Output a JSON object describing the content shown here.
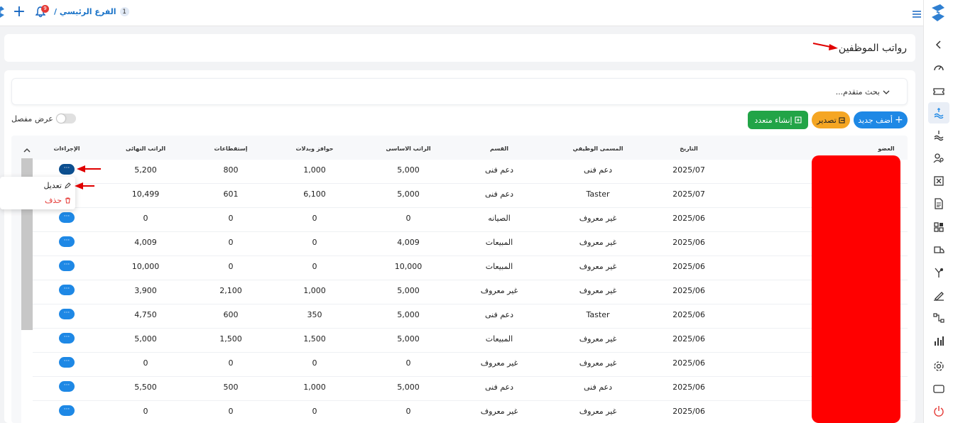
{
  "topbar": {
    "branch_number": "1",
    "branch_label": "الفرع الرئيسي /",
    "notification_count": "9"
  },
  "page": {
    "title": "رواتب الموظفين"
  },
  "search": {
    "advanced_label": "بحث متقدم..."
  },
  "toolbar": {
    "add_label": "أضف جديد",
    "export_label": "تصدير",
    "multi_create_label": "إنشاء متعدد",
    "detailed_view_label": "عرض مفصل"
  },
  "table": {
    "headers": {
      "member": "العضو",
      "date": "التاريخ",
      "job_title": "المسمى الوظيفي",
      "department": "القسم",
      "base_salary": "الراتب الاساسى",
      "allowances": "حوافز وبدلات",
      "deductions": "إستقطاعات",
      "final_salary": "الراتب النهائى",
      "actions": "الإجراءات"
    },
    "action_glyph": "···",
    "rows": [
      {
        "date": "2025/07",
        "job_title": "دعم فنى",
        "department": "دعم فنى",
        "base_salary": "5,000",
        "allowances": "1,000",
        "deductions": "800",
        "final_salary": "5,200"
      },
      {
        "date": "2025/07",
        "job_title": "Taster",
        "department": "دعم فنى",
        "base_salary": "5,000",
        "allowances": "6,100",
        "deductions": "601",
        "final_salary": "10,499"
      },
      {
        "date": "2025/06",
        "job_title": "غير معروف",
        "department": "الصيانه",
        "base_salary": "0",
        "allowances": "0",
        "deductions": "0",
        "final_salary": "0"
      },
      {
        "date": "2025/06",
        "job_title": "غير معروف",
        "department": "المبيعات",
        "base_salary": "4,009",
        "allowances": "0",
        "deductions": "0",
        "final_salary": "4,009"
      },
      {
        "date": "2025/06",
        "job_title": "غير معروف",
        "department": "المبيعات",
        "base_salary": "10,000",
        "allowances": "0",
        "deductions": "0",
        "final_salary": "10,000"
      },
      {
        "date": "2025/06",
        "job_title": "غير معروف",
        "department": "غير معروف",
        "base_salary": "5,000",
        "allowances": "1,000",
        "deductions": "2,100",
        "final_salary": "3,900"
      },
      {
        "date": "2025/06",
        "job_title": "Taster",
        "department": "دعم فنى",
        "base_salary": "5,000",
        "allowances": "350",
        "deductions": "600",
        "final_salary": "4,750"
      },
      {
        "date": "2025/06",
        "job_title": "غير معروف",
        "department": "المبيعات",
        "base_salary": "5,000",
        "allowances": "1,500",
        "deductions": "1,500",
        "final_salary": "5,000"
      },
      {
        "date": "2025/06",
        "job_title": "غير معروف",
        "department": "غير معروف",
        "base_salary": "0",
        "allowances": "0",
        "deductions": "0",
        "final_salary": "0"
      },
      {
        "date": "2025/06",
        "job_title": "دعم فنى",
        "department": "دعم فنى",
        "base_salary": "5,000",
        "allowances": "1,000",
        "deductions": "500",
        "final_salary": "5,500"
      },
      {
        "date": "2025/06",
        "job_title": "غير معروف",
        "department": "غير معروف",
        "base_salary": "0",
        "allowances": "0",
        "deductions": "0",
        "final_salary": "0"
      }
    ]
  },
  "row_menu": {
    "edit_label": "تعديل",
    "delete_label": "حذف"
  },
  "colors": {
    "primary": "#1e88e5",
    "warning": "#f5a623",
    "success": "#22a447",
    "danger": "#e53935",
    "annotation_arrow": "#e00000",
    "redaction": "#ff0000"
  },
  "icons": {
    "sidebar": [
      "chevron-left-icon",
      "dashboard-icon",
      "ticket-icon",
      "salary-icon",
      "money-hand-icon",
      "users-icon",
      "excel-icon",
      "document-icon",
      "apps-icon",
      "truck-icon",
      "tools-icon",
      "signature-icon",
      "workflow-icon",
      "report-icon",
      "gear-icon",
      "window-icon",
      "power-icon"
    ]
  }
}
